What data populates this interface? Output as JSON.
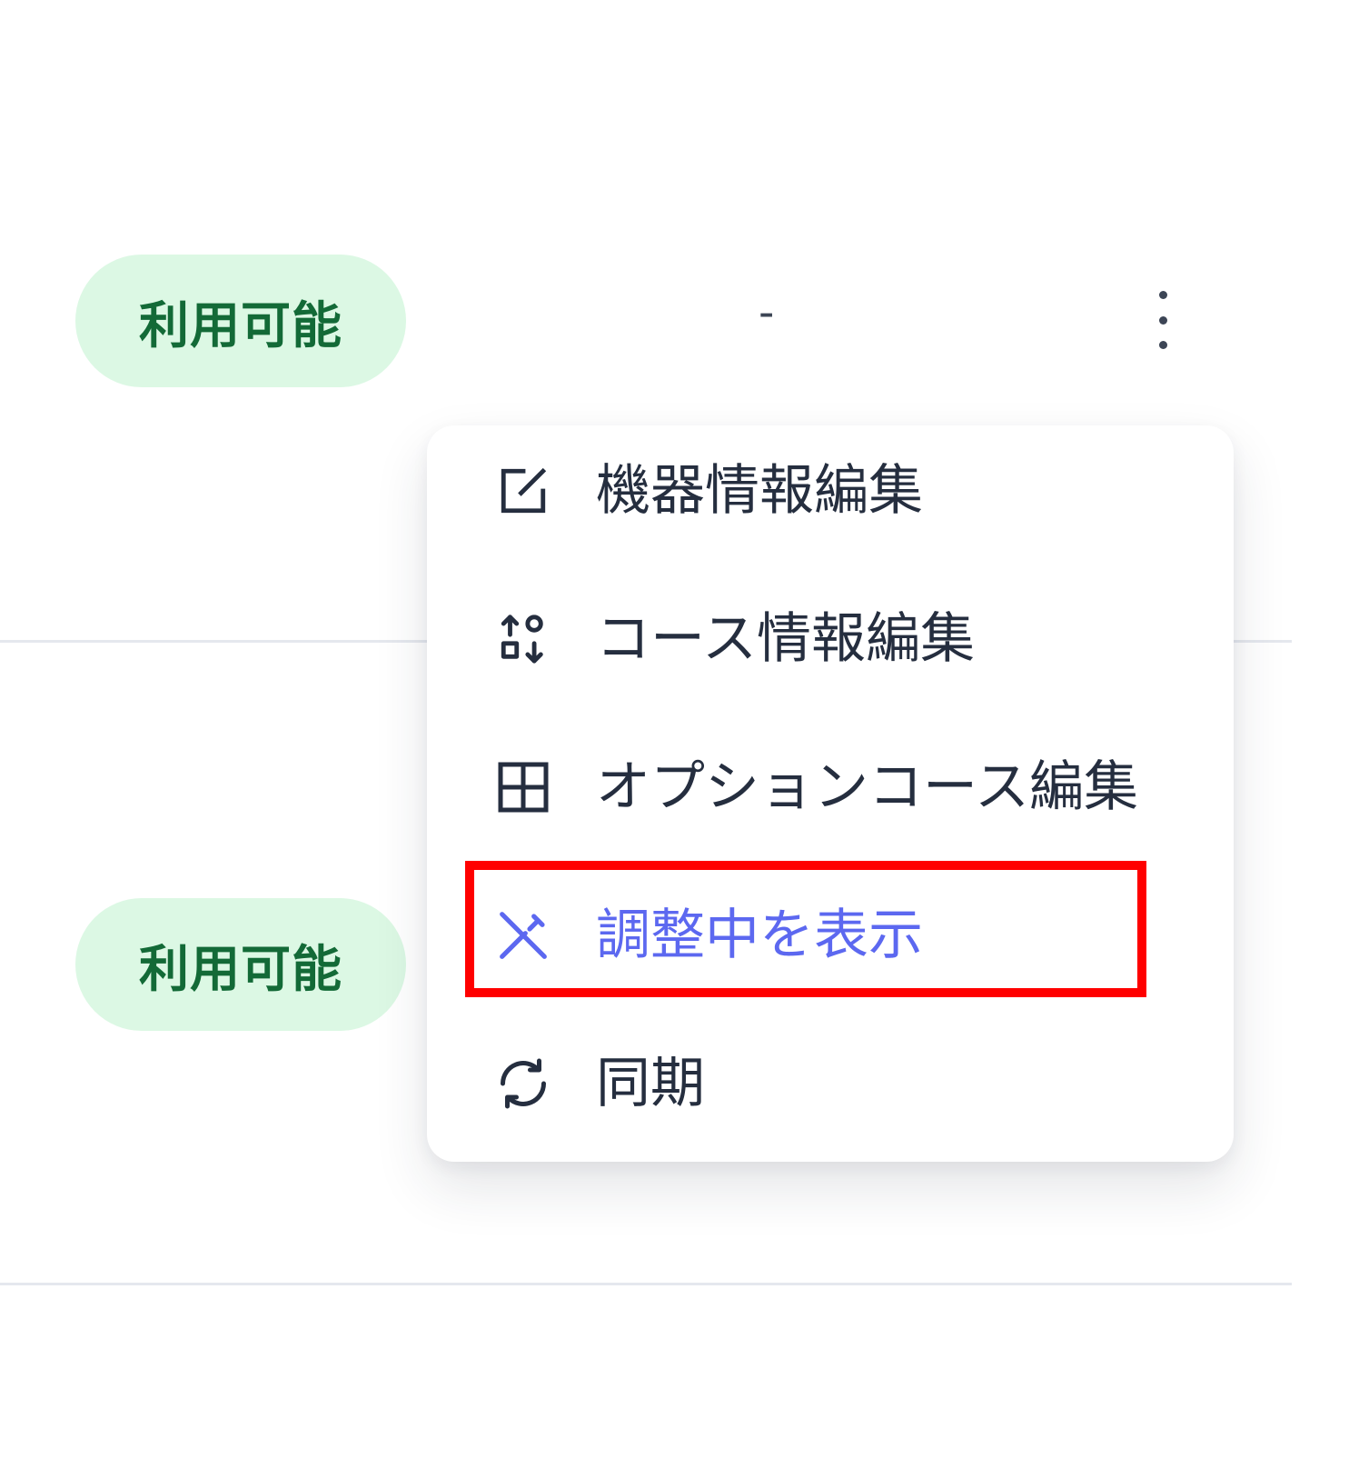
{
  "rows": [
    {
      "status_badge": "利用可能",
      "value": "-"
    },
    {
      "status_badge": "利用可能"
    }
  ],
  "menu": {
    "items": [
      {
        "label": "機器情報編集",
        "icon": "edit-square-icon"
      },
      {
        "label": "コース情報編集",
        "icon": "shapes-sort-icon"
      },
      {
        "label": "オプションコース編集",
        "icon": "table-grid-icon"
      },
      {
        "label": "調整中を表示",
        "icon": "tools-icon",
        "state": "highlighted"
      },
      {
        "label": "同期",
        "icon": "sync-icon"
      }
    ]
  },
  "colors": {
    "badge_bg": "#dcf8e4",
    "badge_text": "#136a37",
    "menu_text": "#252e3f",
    "active_text": "#5c68f0",
    "highlight_border": "#ff0000"
  }
}
